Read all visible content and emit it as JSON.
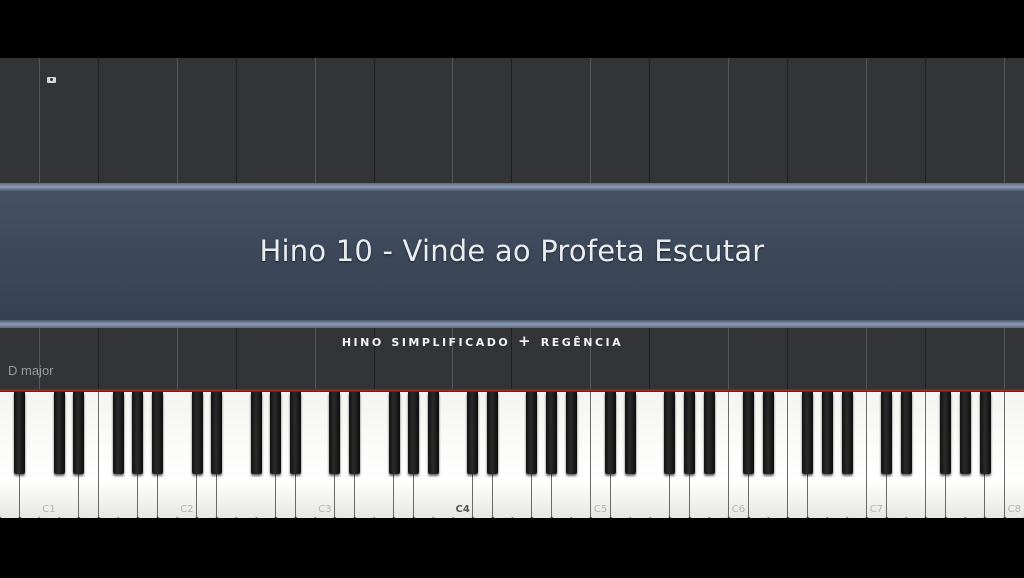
{
  "banner": {
    "title": "Hino 10 - Vinde ao Profeta Escutar"
  },
  "subtitle": "hino simplificado + regência",
  "key_signature": "D major",
  "keyboard": {
    "octave_labels": [
      "C1",
      "C2",
      "C3",
      "C4",
      "C5",
      "C6",
      "C7",
      "C8"
    ],
    "highlighted_label": "C4"
  },
  "colors": {
    "background": "#333435",
    "banner": "#3f4a5c",
    "accent_red": "#b02a2a"
  },
  "icons": [
    "camera-icon"
  ]
}
